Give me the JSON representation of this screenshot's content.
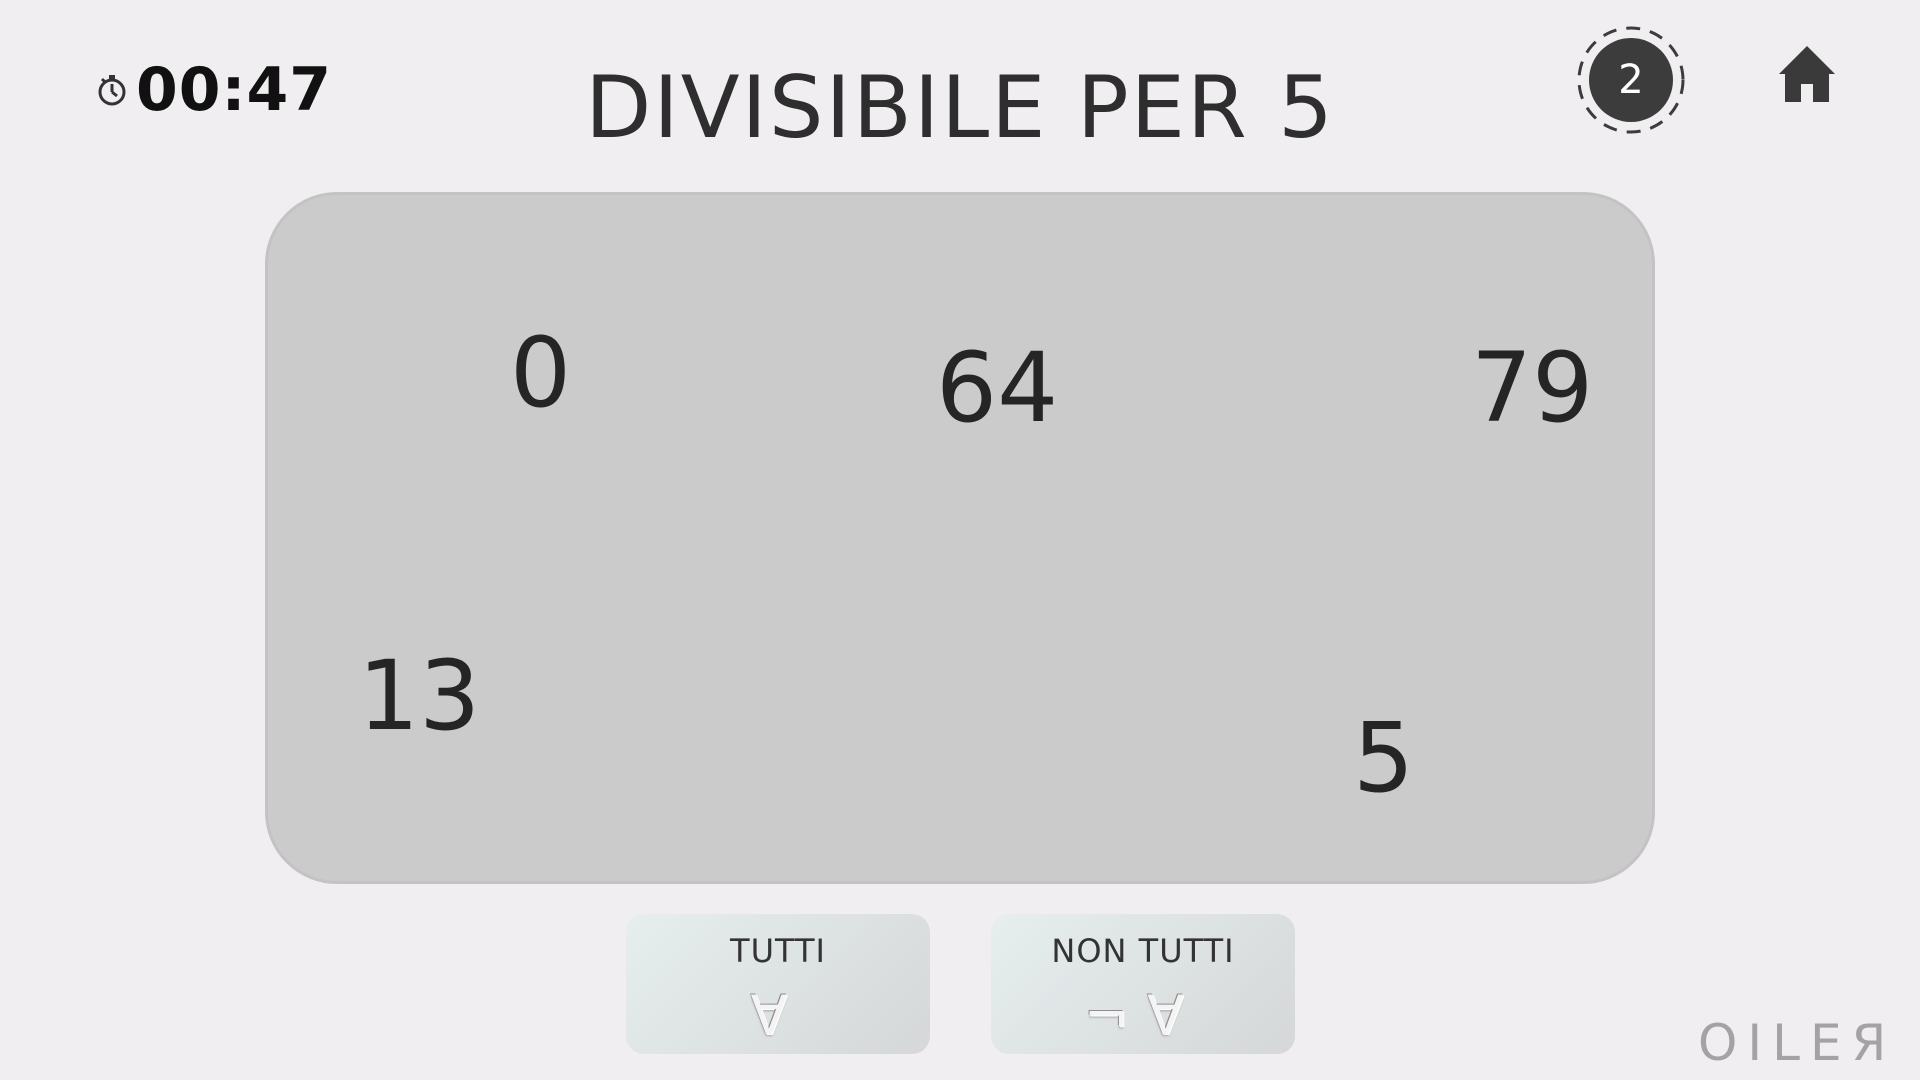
{
  "timer": {
    "value": "00:47",
    "icon": "stopwatch-icon"
  },
  "title": "DIVISIBILE PER 5",
  "level": {
    "value": "2"
  },
  "home": {
    "icon": "home-icon"
  },
  "board": {
    "numbers": [
      "0",
      "64",
      "79",
      "13",
      "5"
    ]
  },
  "answers": {
    "all": {
      "label": "TUTTI",
      "symbol": "∀"
    },
    "not_all": {
      "label": "NON TUTTI",
      "symbol": "¬∀"
    }
  },
  "brand": "OILEЯ",
  "colors": {
    "background": "#f0eef1",
    "board": "#cbcbcb",
    "level_badge": "#3c3c3c",
    "text": "#2b2b2b"
  }
}
